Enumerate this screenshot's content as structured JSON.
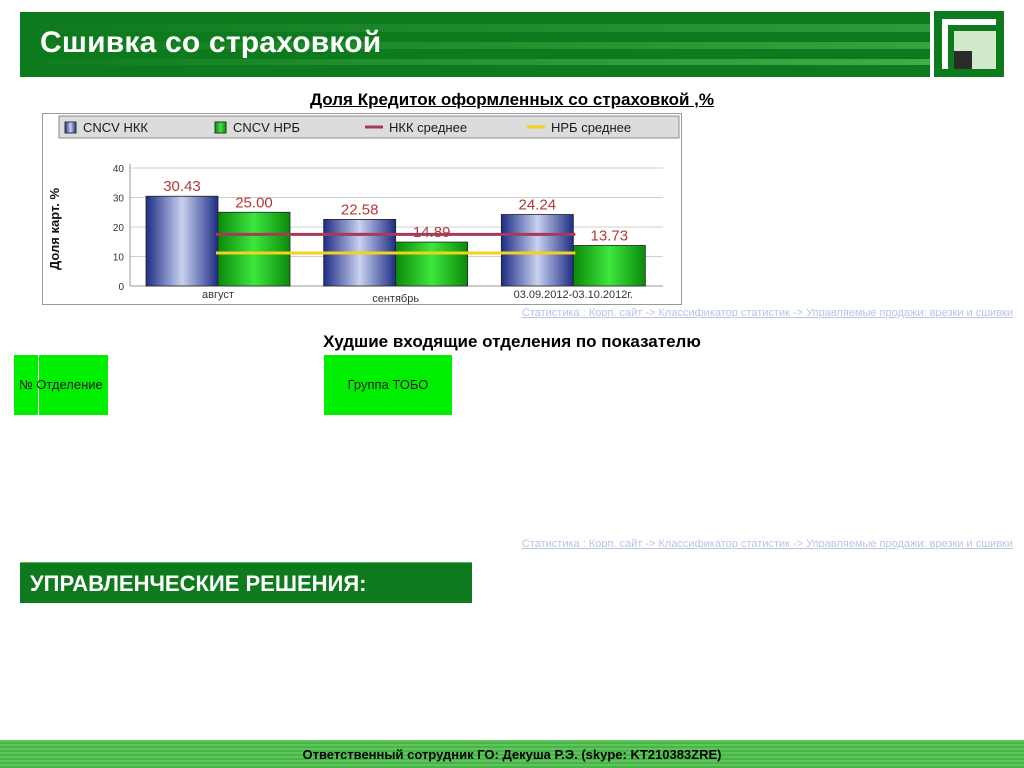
{
  "header": {
    "title": "Сшивка со страховкой"
  },
  "chart_data": {
    "type": "bar",
    "title": "Доля Кредиток оформленных со страховкой ,%",
    "ylabel": "Доля карт. %",
    "xlabel": "",
    "ylim": [
      0,
      40
    ],
    "yticks": [
      0,
      10,
      20,
      30,
      40
    ],
    "grid": true,
    "legend_position": "top",
    "categories": [
      "август",
      "сентябрь",
      "03.09.2012-03.10.2012г."
    ],
    "series": [
      {
        "name": "CNCV НКК",
        "kind": "bar",
        "color": "#2b3e9a",
        "values": [
          30.43,
          22.58,
          24.24
        ]
      },
      {
        "name": "CNCV НРБ",
        "kind": "bar",
        "color": "#14b414",
        "values": [
          25.0,
          14.89,
          13.73
        ]
      },
      {
        "name": "НКК среднее",
        "kind": "line",
        "color": "#a53a5a",
        "value": 17.5
      },
      {
        "name": "НРБ среднее",
        "kind": "line",
        "color": "#f2d21a",
        "value": 11.2
      }
    ],
    "data_labels": [
      "30.43",
      "25.00",
      "22.58",
      "14.89",
      "24.24",
      "13.73"
    ]
  },
  "source_link_1": "Статистика : Корп. сайт -> Классификатор статистик -> Управляемые продажи: врезки и сшивки",
  "worst_section": {
    "title": "Худшие входящие отделения по показателю",
    "col_number": "№",
    "col_branch": "Отделение",
    "col_group": "Группа ТОБО"
  },
  "source_link_2": "Статистика : Корп. сайт -> Классификатор статистик -> Управляемые продажи: врезки и сшивки",
  "decisions": {
    "title": "УПРАВЛЕНЧЕСКИЕ РЕШЕНИЯ:"
  },
  "footer": {
    "text": "Ответственный сотрудник ГО: Декуша Р.Э. (skype: KT210383ZRE)"
  }
}
